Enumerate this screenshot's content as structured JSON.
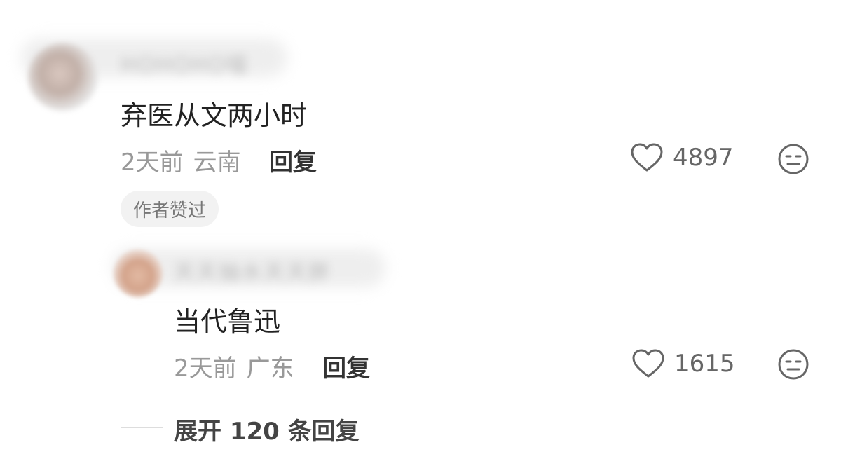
{
  "comments": [
    {
      "username": "HOHOHO喵",
      "text": "弃医从文两小时",
      "time": "2天前",
      "location": "云南",
      "reply_label": "回复",
      "likes": "4897",
      "badge": "作者赞过"
    }
  ],
  "replies": [
    {
      "username": "天天抽水天天胖",
      "text": "当代鲁迅",
      "time": "2天前",
      "location": "广东",
      "reply_label": "回复",
      "likes": "1615"
    }
  ],
  "expand_label": "展开 120 条回复",
  "icons": {
    "like": "heart-outline-icon",
    "emoji": "neutral-face-icon"
  },
  "colors": {
    "text_primary": "#222222",
    "text_secondary": "#999999",
    "badge_bg": "#f2f2f2"
  }
}
